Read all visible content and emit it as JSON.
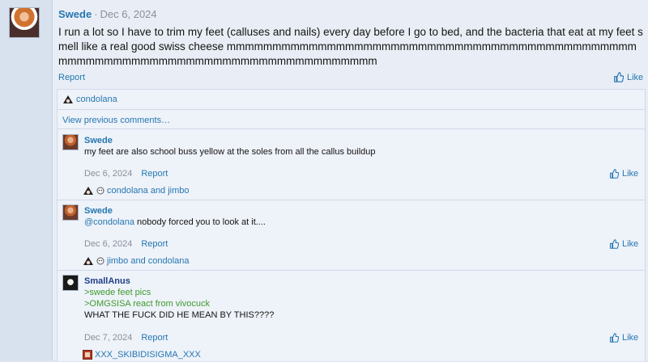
{
  "post": {
    "author": "Swede",
    "date": "Dec 6, 2024",
    "body": "I run a lot so I have to trim my feet (calluses and nails) every day before I go to bed, and the bacteria that eat at my feet smell like a real good swiss cheese mmmmmmmmmmmmmmmmmmmmmmmmmmmmmmmmmmmmmmmmmmmmmmmmmmmmmmmmmmmmmmmmmmmmmmmmmmmmmmmm",
    "report_label": "Report",
    "like_label": "Like"
  },
  "comments_block": {
    "likers": "condolana",
    "view_previous": "View previous comments…"
  },
  "comments": [
    {
      "author": "Swede",
      "text": "my feet are also school buss yellow at the soles from all the callus buildup",
      "date": "Dec 6, 2024",
      "report_label": "Report",
      "like_label": "Like",
      "likers": "condolana and jimbo"
    },
    {
      "author": "Swede",
      "mention": "@condolana",
      "text": " nobody forced you to look at it....",
      "date": "Dec 6, 2024",
      "report_label": "Report",
      "like_label": "Like",
      "likers": "jimbo and condolana"
    },
    {
      "author": "SmallAnus",
      "greentext1": ">swede feet pics",
      "greentext2": ">OMGSISA react from vivocuck",
      "text": "WHAT THE FUCK DID HE MEAN BY THIS????",
      "date": "Dec 7, 2024",
      "report_label": "Report",
      "like_label": "Like",
      "likers": "XXX_SKIBIDISIGMA_XXX"
    }
  ],
  "colors": {
    "link": "#2577b1",
    "greentext": "#3e9b2e",
    "meta": "#8a8f98"
  }
}
